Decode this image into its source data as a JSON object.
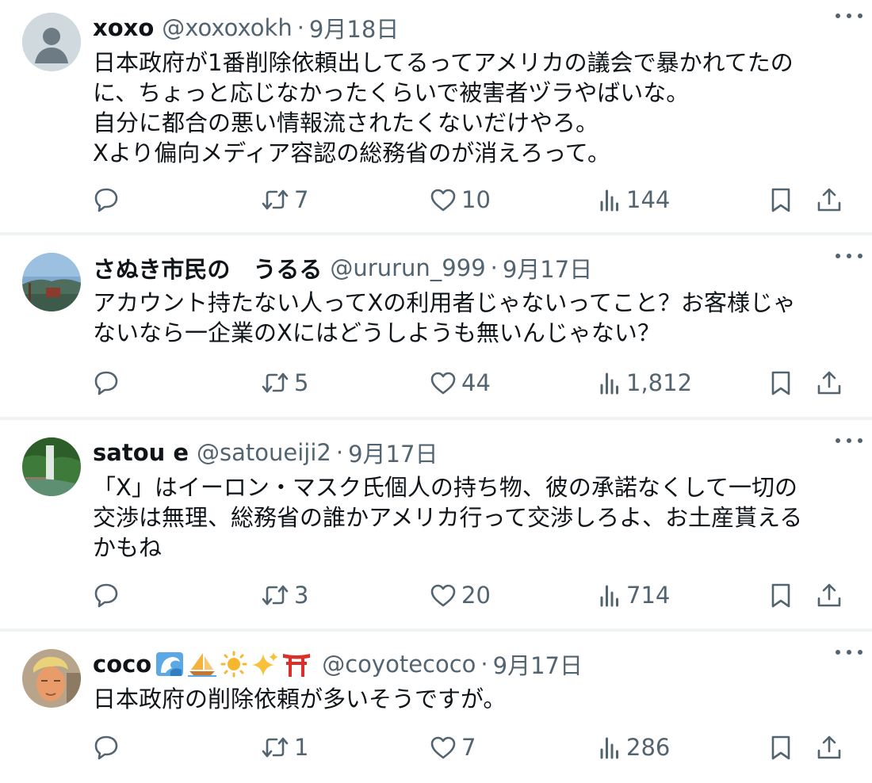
{
  "tweets": [
    {
      "name": "xoxo",
      "handle": "@xoxoxokh",
      "dot": "·",
      "date": "9月18日",
      "lines": [
        "日本政府が1番削除依頼出してるってアメリカの議会で暴かれてたの",
        "に、ちょっと応じなかったくらいで被害者ヅラやばいな。",
        "自分に都合の悪い情報流されたくないだけやろ。",
        "Xより偏向メディア容認の総務省のが消えろって。"
      ],
      "retweets": "7",
      "likes": "10",
      "views": "144"
    },
    {
      "name": "さぬき市民の　うるる",
      "handle": "@ururun_999",
      "dot": "·",
      "date": "9月17日",
      "lines": [
        "アカウント持たない人ってXの利用者じゃないってこと？お客様じゃ",
        "ないなら一企業のXにはどうしようも無いんじゃない？"
      ],
      "retweets": "5",
      "likes": "44",
      "views": "1,812"
    },
    {
      "name": "satou e",
      "handle": "@satoueiji2",
      "dot": "·",
      "date": "9月17日",
      "lines": [
        "「X」はイーロン・マスク氏個人の持ち物、彼の承諾なくして一切の",
        "交渉は無理、総務省の誰かアメリカ行って交渉しろよ、お土産貰える",
        "かもね"
      ],
      "retweets": "3",
      "likes": "20",
      "views": "714"
    },
    {
      "name": "coco",
      "name_emojis": [
        "wave-emoji",
        "sailboat-emoji",
        "sun-emoji",
        "sparkles-emoji",
        "torii-emoji"
      ],
      "handle": "@coyotecoco",
      "dot": "·",
      "date": "9月17日",
      "lines": [
        "日本政府の削除依頼が多いそうですが。"
      ],
      "retweets": "1",
      "likes": "7",
      "views": "286"
    }
  ],
  "colors": {
    "text": "#0f1419",
    "secondary": "#536471",
    "divider": "#eff3f4"
  }
}
